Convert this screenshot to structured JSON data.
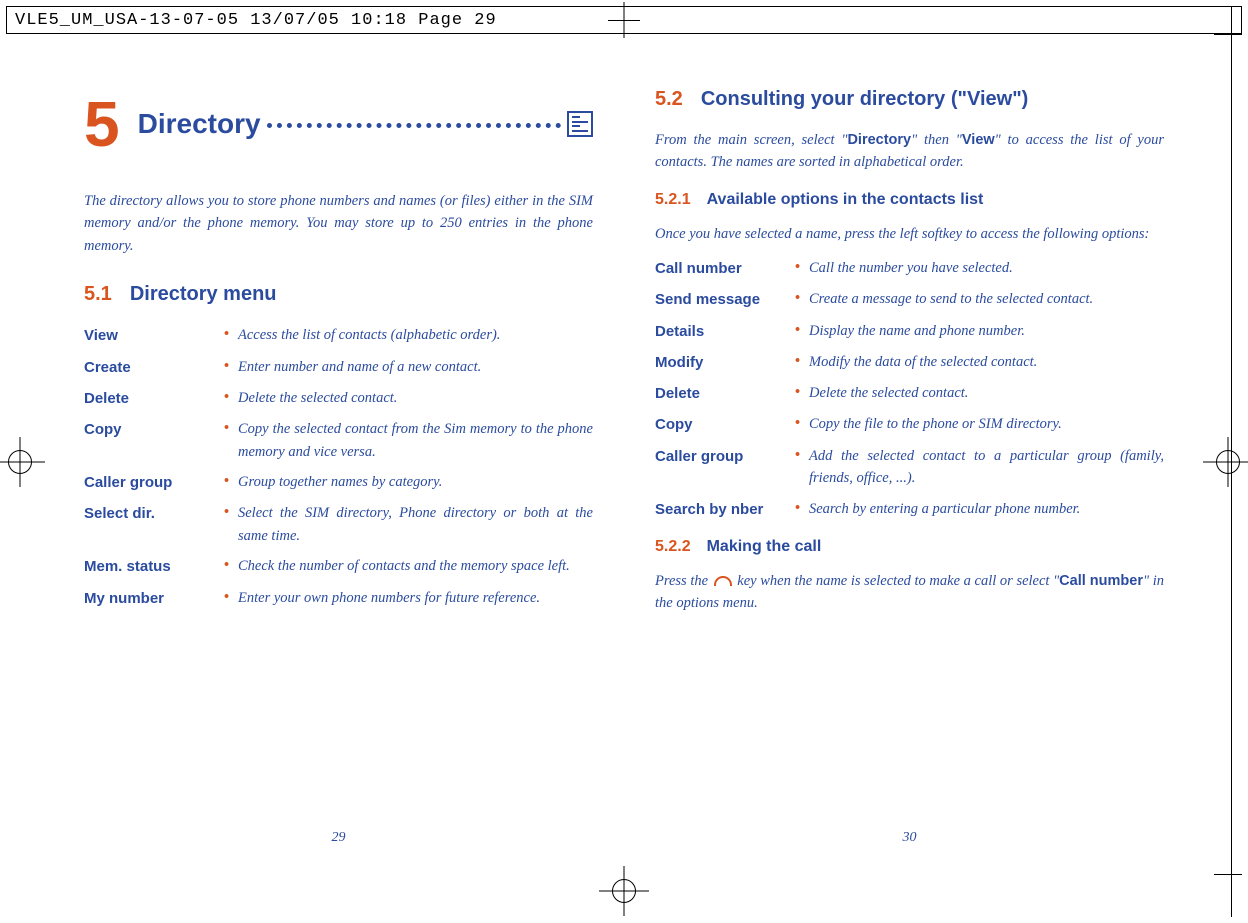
{
  "header": "VLE5_UM_USA-13-07-05  13/07/05  10:18  Page 29",
  "chapter": {
    "number": "5",
    "title": "Directory"
  },
  "intro": "The directory allows you to store phone numbers and names (or files) either in the SIM memory and/or the phone memory. You may store up to 250 entries in the phone memory.",
  "s51": {
    "num": "5.1",
    "title": "Directory menu"
  },
  "menu": [
    {
      "term": "View",
      "desc": "Access the list of contacts (alphabetic order)."
    },
    {
      "term": "Create",
      "desc": "Enter number and name of a new contact."
    },
    {
      "term": "Delete",
      "desc": "Delete the selected contact."
    },
    {
      "term": "Copy",
      "desc": "Copy the selected contact from the Sim memory to the phone memory and vice versa."
    },
    {
      "term": "Caller group",
      "desc": "Group together names by category."
    },
    {
      "term": "Select dir.",
      "desc": "Select the SIM directory, Phone directory or both at the same time."
    },
    {
      "term": "Mem. status",
      "desc": "Check the number of contacts and the memory space left."
    },
    {
      "term": "My number",
      "desc": "Enter your own phone numbers for future reference."
    }
  ],
  "s52": {
    "num": "5.2",
    "title": "Consulting your directory (\"View\")"
  },
  "s52_para_pre": "From the main screen, select \"",
  "s52_para_b1": "Directory",
  "s52_para_mid1": "\" then \"",
  "s52_para_b2": "View",
  "s52_para_post": "\" to access the list of your contacts. The names are sorted in alphabetical order.",
  "s521": {
    "num": "5.2.1",
    "title": "Available options in the contacts list"
  },
  "s521_intro": "Once you have selected a name, press the left softkey to access the following options:",
  "opts": [
    {
      "term": "Call number",
      "desc": "Call the number you have selected."
    },
    {
      "term": "Send message",
      "desc": "Create a message to send to the selected contact."
    },
    {
      "term": "Details",
      "desc": "Display the name and phone number."
    },
    {
      "term": "Modify",
      "desc": "Modify the data of the selected contact."
    },
    {
      "term": "Delete",
      "desc": "Delete the selected contact."
    },
    {
      "term": "Copy",
      "desc": "Copy the file to the phone or SIM directory."
    },
    {
      "term": "Caller group",
      "desc": "Add the selected contact to a particular group (family, friends, office, ...)."
    },
    {
      "term": "Search by nber",
      "desc": "Search by entering a particular phone number."
    }
  ],
  "s522": {
    "num": "5.2.2",
    "title": "Making the call"
  },
  "s522_pre": "Press the ",
  "s522_mid": " key when the name is selected to make a call or select \"",
  "s522_b": "Call number",
  "s522_post": "\" in the options menu.",
  "page_left": "29",
  "page_right": "30"
}
